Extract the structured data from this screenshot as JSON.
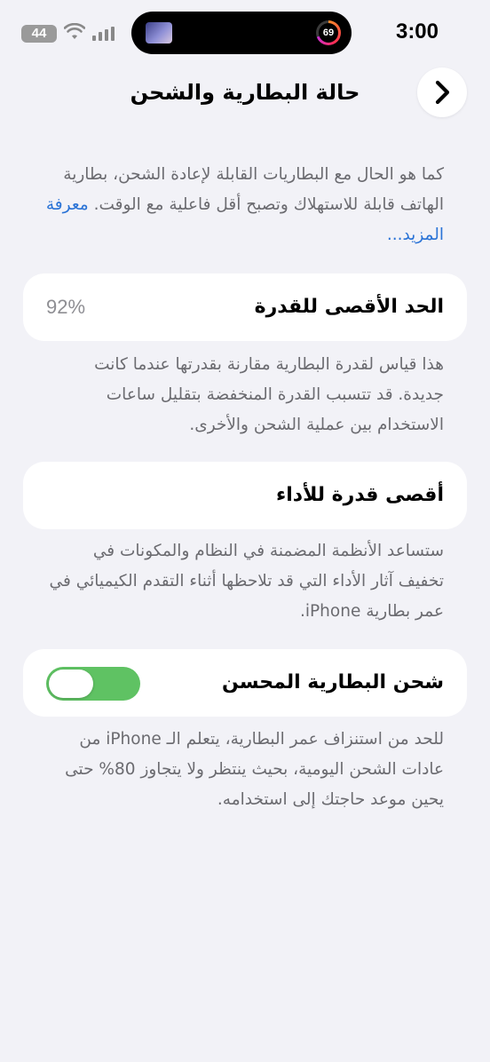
{
  "status_bar": {
    "time": "3:00",
    "activity_ring_value": "69",
    "battery_badge": "44",
    "icons": [
      "cellular-signal-icon",
      "wifi-icon"
    ]
  },
  "nav": {
    "title": "حالة البطارية والشحن",
    "back_icon": "chevron-right-icon"
  },
  "intro": {
    "text": "كما هو الحال مع البطاريات القابلة لإعادة الشحن، بطارية الهاتف قابلة للاستهلاك وتصبح أقل فاعلية مع الوقت.",
    "learn_more": "معرفة المزيد..."
  },
  "max_capacity": {
    "label": "الحد الأقصى للقدرة",
    "value": "92%",
    "description": "هذا قياس لقدرة البطارية مقارنة بقدرتها عندما كانت جديدة. قد تتسبب القدرة المنخفضة بتقليل ساعات الاستخدام بين عملية الشحن والأخرى."
  },
  "peak_performance": {
    "label": "أقصى قدرة للأداء",
    "description": "ستساعد الأنظمة المضمنة في النظام والمكونات في تخفيف آثار الأداء التي قد تلاحظها أثناء التقدم الكيميائي في عمر بطارية iPhone."
  },
  "optimized_charging": {
    "label": "شحن البطارية المحسن",
    "enabled": true,
    "description": "للحد من استنزاف عمر البطارية، يتعلم الـ iPhone من عادات الشحن اليومية، بحيث ينتظر ولا يتجاوز 80% حتى يحين موعد حاجتك إلى استخدامه."
  },
  "colors": {
    "background": "#f2f2f7",
    "link": "#2a73d6",
    "toggle_on": "#5fc263",
    "secondary_text": "#6b6b70"
  }
}
